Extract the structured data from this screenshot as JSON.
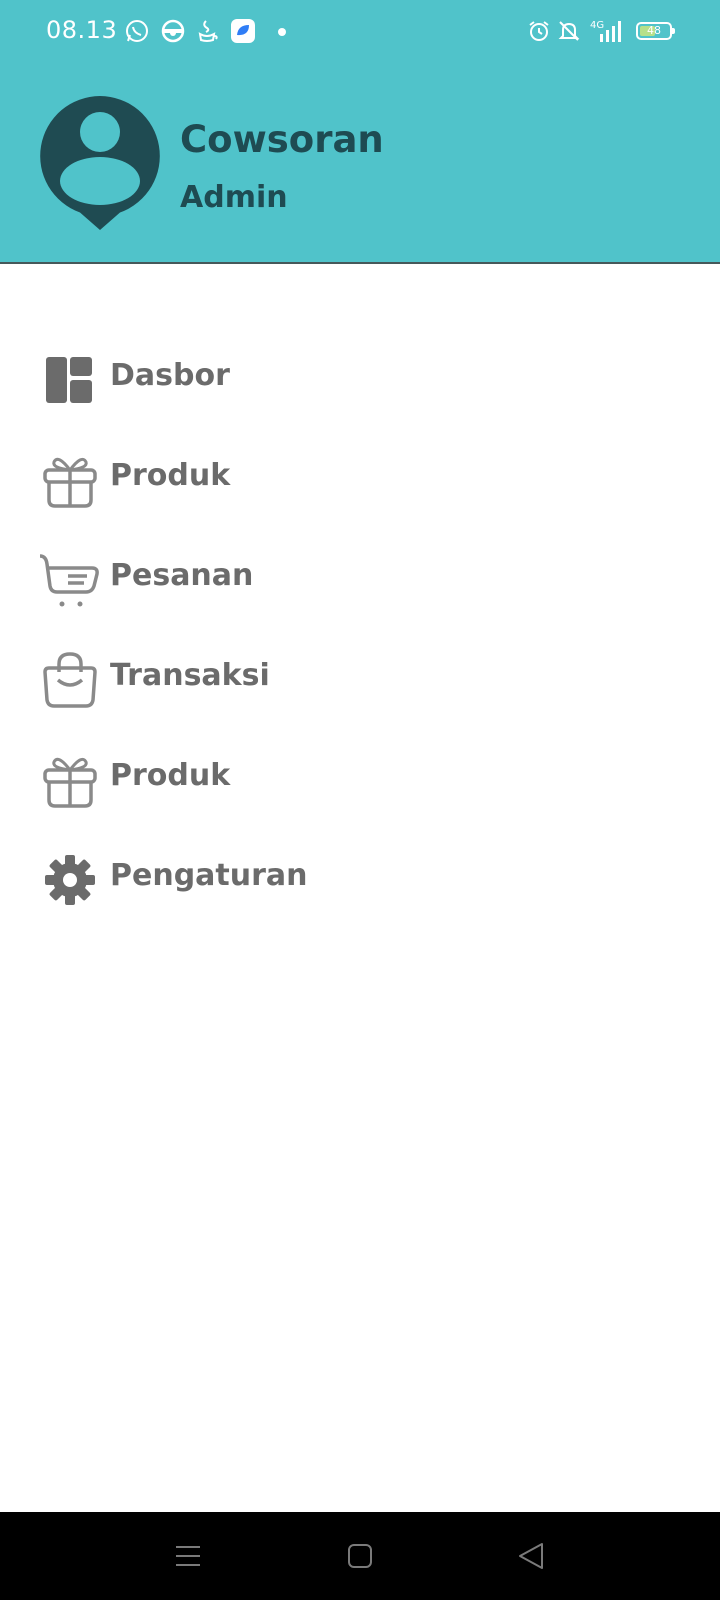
{
  "status_bar": {
    "time": "08.13",
    "network": "4G",
    "battery_level": "48",
    "icons": [
      "whatsapp-icon",
      "steering-wheel-icon",
      "java-icon",
      "app-icon",
      "alarm-icon",
      "mute-icon",
      "signal-icon",
      "battery-icon"
    ]
  },
  "profile": {
    "name": "Cowsoran",
    "role": "Admin"
  },
  "menu": {
    "items": [
      {
        "label": "Dasbor",
        "icon": "dashboard-icon"
      },
      {
        "label": "Produk",
        "icon": "gift-icon"
      },
      {
        "label": "Pesanan",
        "icon": "cart-icon"
      },
      {
        "label": "Transaksi",
        "icon": "bag-icon"
      },
      {
        "label": "Produk",
        "icon": "gift-icon"
      },
      {
        "label": "Pengaturan",
        "icon": "gear-icon"
      }
    ]
  },
  "colors": {
    "header_bg": "#50c3ca",
    "profile_text": "#1e4b52",
    "menu_text": "#6b6b6b",
    "nav_bg": "#000000"
  },
  "nav_bar": {
    "buttons": [
      "menu-button",
      "home-button",
      "back-button"
    ]
  }
}
